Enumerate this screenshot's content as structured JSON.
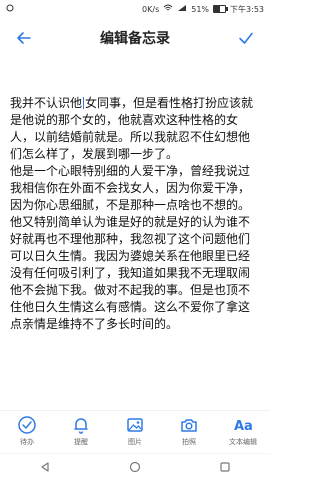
{
  "status_bar": {
    "speed": "0K/s",
    "battery": "51%",
    "time": "下午3:53"
  },
  "app_bar": {
    "title": "编辑备忘录"
  },
  "note": {
    "before_caret": "我并不认识他",
    "after_caret": "女同事，但是看性格打扮应该就是他说的那个女的，他就喜欢这种性格的女人，以前结婚前就是。所以我就忍不住幻想他们怎么样了，发展到哪一步了。",
    "paragraphs": [
      "他是一个心眼特别细的人爱干净，曾经我说过我相信你在外面不会找女人，因为你爱干净，因为你心思细腻，不是那种一点啥也不想的。",
      "他又特别简单认为谁是好的就是好的认为谁不好就再也不理他那种，我忽视了这个问题他们可以日久生情。我因为婆媳关系在他眼里已经没有任何吸引利了，我知道如果我不无理取闹他不会抛下我。做对不起我的事。但是也顶不住他日久生情这么有感情。这么不爱你了拿这点亲情是维持不了多长时间的。"
    ]
  },
  "toolbar": {
    "items": [
      {
        "label": "待办",
        "icon": "check-circle-icon"
      },
      {
        "label": "提醒",
        "icon": "bell-icon"
      },
      {
        "label": "图片",
        "icon": "image-icon"
      },
      {
        "label": "拍照",
        "icon": "camera-icon"
      },
      {
        "label": "文本编辑",
        "icon": "text-format-icon"
      }
    ]
  },
  "colors": {
    "accent": "#2e7ae6",
    "text": "#111111"
  }
}
